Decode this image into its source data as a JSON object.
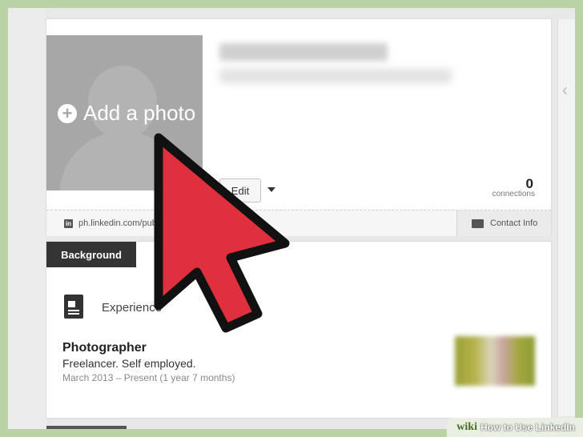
{
  "profile": {
    "add_photo_label": "Add a photo",
    "edit_label": "Edit",
    "connections_count": "0",
    "connections_label": "connections",
    "public_url": "ph.linkedin.com/pub/",
    "contact_info_label": "Contact Info"
  },
  "background": {
    "tab_label": "Background",
    "section_title": "Experience",
    "job": {
      "title": "Photographer",
      "company": "Freelancer. Self employed.",
      "dates": "March 2013 – Present (1 year 7 months)"
    }
  },
  "icons": {
    "plus": "plus-circle-icon",
    "linkedin": "linkedin-icon",
    "contact": "contact-card-icon",
    "experience": "briefcase-document-icon",
    "collapse": "chevron-left-icon",
    "cursor": "red-arrow-pointer"
  },
  "colors": {
    "pointer_fill": "#e0303e",
    "tab_bg": "#343434",
    "frame_bg": "#b9d2a6"
  },
  "watermark": {
    "brand": "wiki",
    "title": "How to Use LinkedIn"
  }
}
